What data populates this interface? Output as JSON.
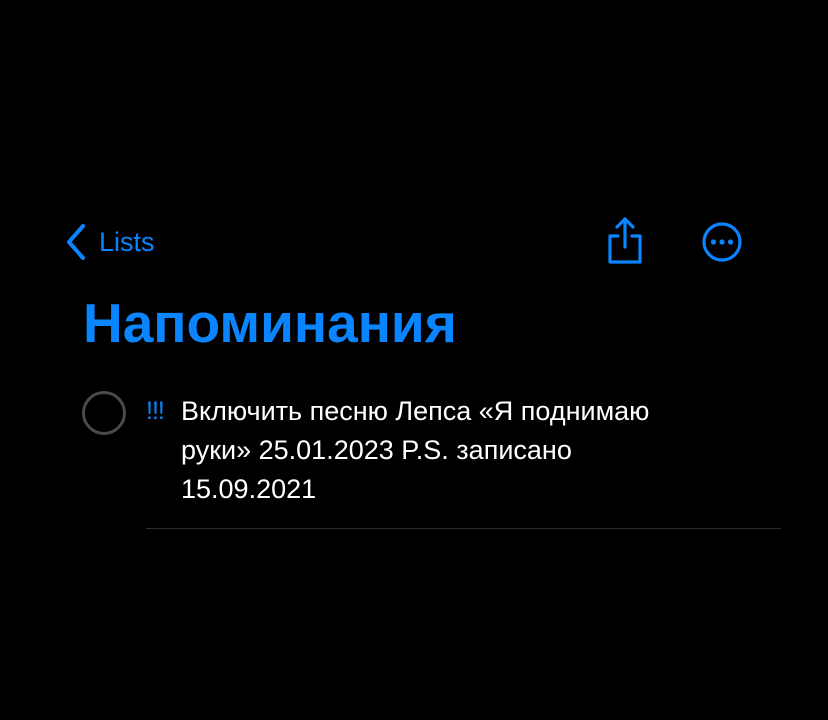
{
  "nav": {
    "back_label": "Lists",
    "back_icon": "chevron-left-icon",
    "share_icon": "share-icon",
    "more_icon": "ellipsis-circle-icon"
  },
  "list": {
    "title": "Напоминания"
  },
  "reminders": [
    {
      "priority": "!!!",
      "lines": [
        "Включить песню Лепса «Я поднимаю",
        "руки» 25.01.2023 P.S. записано",
        "15.09.2021"
      ],
      "completed": false
    }
  ],
  "colors": {
    "background": "#000000",
    "accent": "#0a84ff",
    "text": "#ffffff",
    "checkbox_border": "#4a4a4c",
    "separator": "#2c2c2e"
  }
}
